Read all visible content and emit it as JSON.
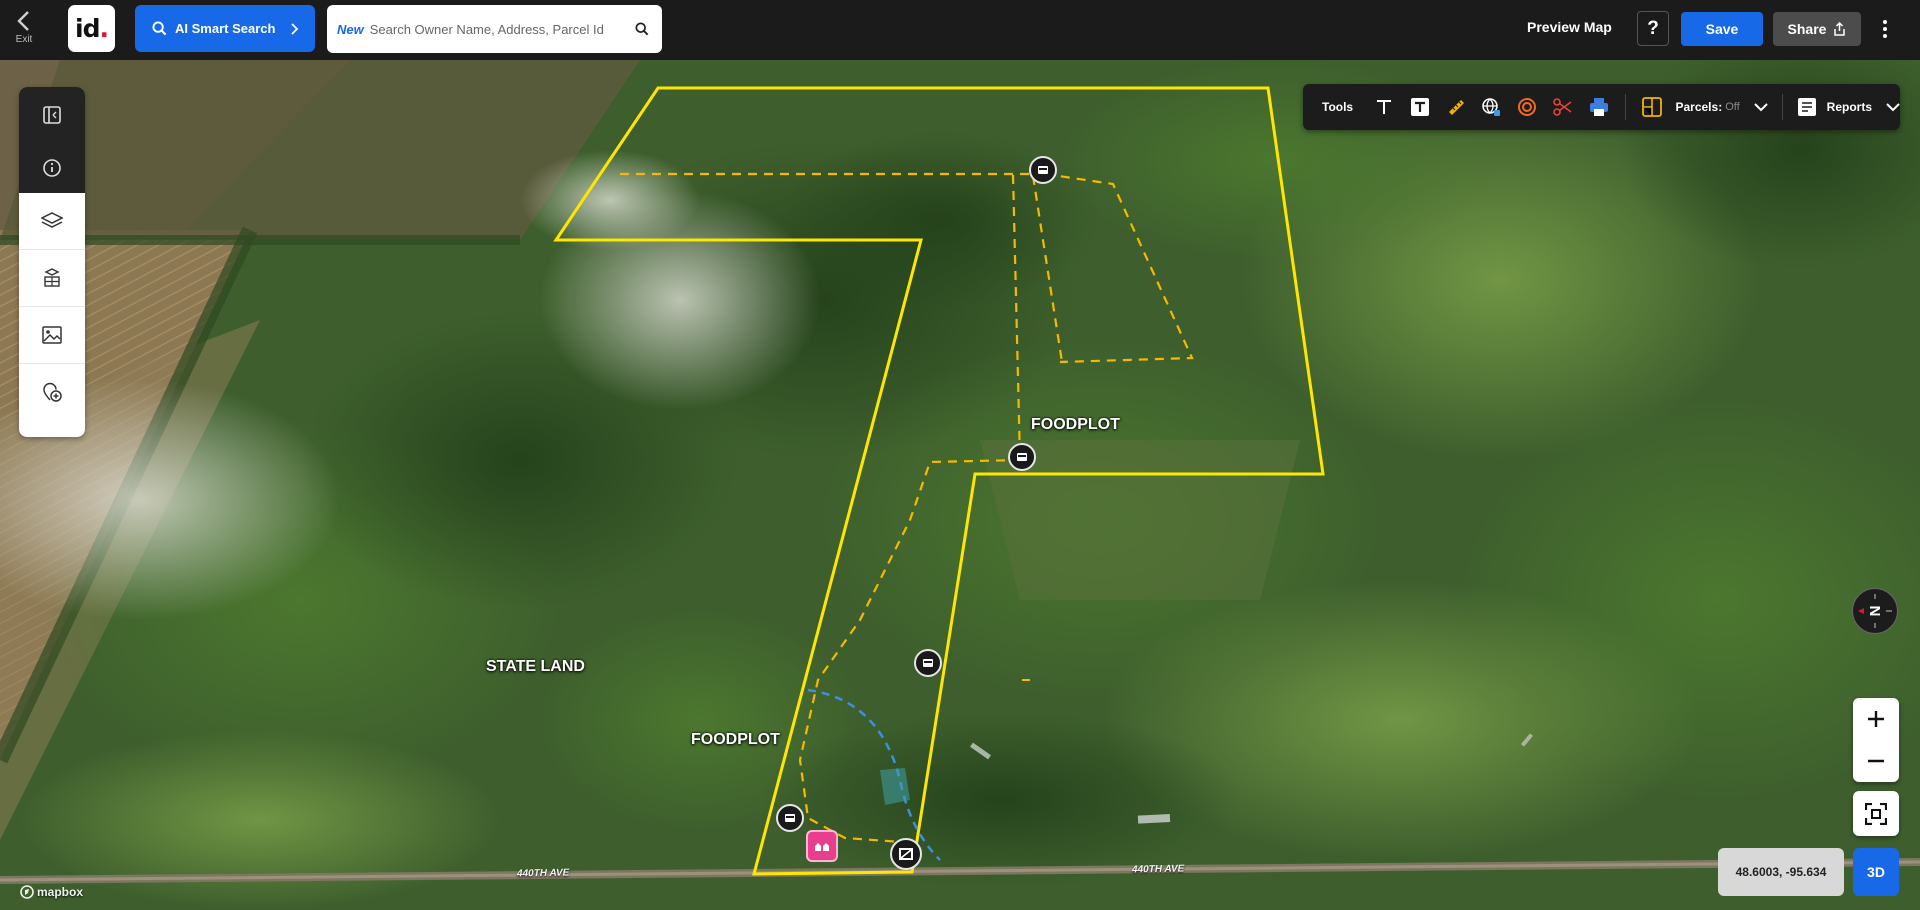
{
  "header": {
    "exit_label": "Exit",
    "logo_text": "id",
    "ai_search_label": "AI Smart Search",
    "search": {
      "badge": "New",
      "placeholder": "Search Owner Name, Address, Parcel Id",
      "value": ""
    },
    "preview_label": "Preview Map",
    "help_label": "?",
    "save_label": "Save",
    "share_label": "Share"
  },
  "toolbar": {
    "tools_label": "Tools",
    "parcels_label": "Parcels:",
    "parcels_state": "Off",
    "reports_label": "Reports"
  },
  "map": {
    "labels": {
      "foodplot_north": "FOODPLOT",
      "foodplot_south": "FOODPLOT",
      "state_land": "STATE LAND",
      "road_west": "440TH AVE",
      "road_east": "440TH AVE"
    },
    "compass_letter": "N",
    "coordinates": "48.6003, -95.634",
    "mode_3d_label": "3D",
    "attribution": "mapbox",
    "colors": {
      "boundary": "#ffe600",
      "trail": "#f5b900",
      "water_line": "#3f8fe0",
      "pink_marker": "#e83e8c",
      "accent_blue": "#1769e8"
    }
  }
}
